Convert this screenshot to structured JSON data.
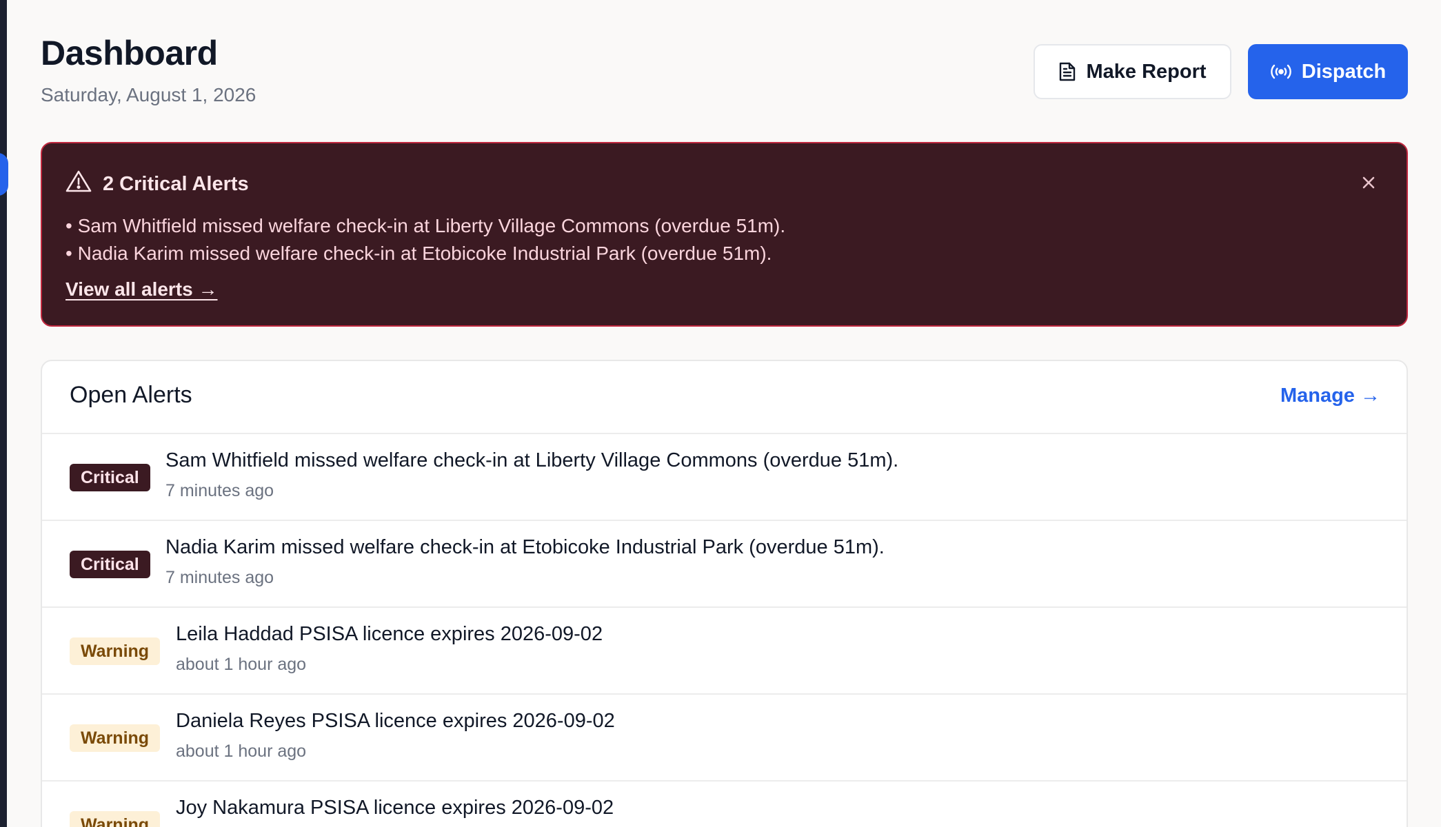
{
  "header": {
    "title": "Dashboard",
    "date": "Saturday, August 1, 2026",
    "make_report_label": "Make Report",
    "dispatch_label": "Dispatch"
  },
  "banner": {
    "title": "2 Critical Alerts",
    "items": [
      "Sam Whitfield missed welfare check-in at Liberty Village Commons (overdue 51m).",
      "Nadia Karim missed welfare check-in at Etobicoke Industrial Park (overdue 51m)."
    ],
    "link_label": "View all alerts →"
  },
  "open_alerts": {
    "title": "Open Alerts",
    "manage_label": "Manage →",
    "rows": [
      {
        "severity": "Critical",
        "text": "Sam Whitfield missed welfare check-in at Liberty Village Commons (overdue 51m).",
        "time": "7 minutes ago"
      },
      {
        "severity": "Critical",
        "text": "Nadia Karim missed welfare check-in at Etobicoke Industrial Park (overdue 51m).",
        "time": "7 minutes ago"
      },
      {
        "severity": "Warning",
        "text": "Leila Haddad PSISA licence expires 2026-09-02",
        "time": "about 1 hour ago"
      },
      {
        "severity": "Warning",
        "text": "Daniela Reyes PSISA licence expires 2026-09-02",
        "time": "about 1 hour ago"
      },
      {
        "severity": "Warning",
        "text": "Joy Nakamura PSISA licence expires 2026-09-02",
        "time": ""
      }
    ]
  },
  "colors": {
    "accent": "#2563eb",
    "critical_bg": "#3b1a22",
    "critical_border": "#c0283f",
    "warning_bg": "#fdf0d7",
    "warning_text": "#7a4a08"
  },
  "icons": {
    "report": "document-icon",
    "dispatch": "broadcast-icon",
    "banner": "warning-triangle-icon",
    "close": "close-icon"
  }
}
